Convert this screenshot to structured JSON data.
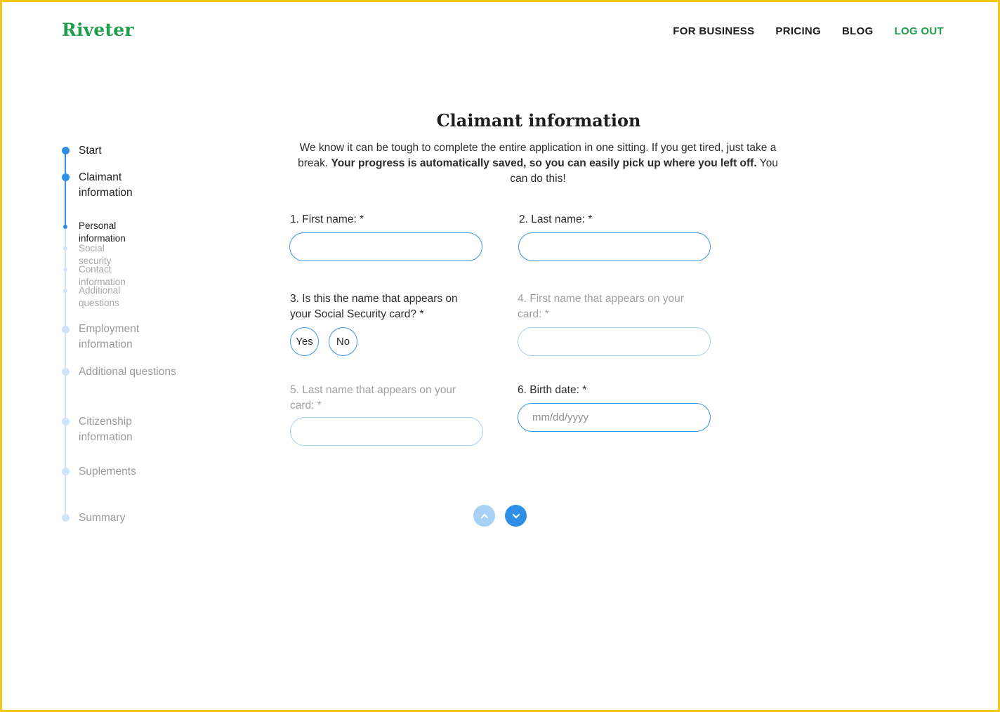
{
  "brand": {
    "logo": "Riveter",
    "color": "#1e9e4a"
  },
  "nav": {
    "for_business": "FOR BUSINESS",
    "pricing": "PRICING",
    "blog": "BLOG",
    "logout": "LOG OUT"
  },
  "stepper": {
    "steps": [
      {
        "label": "Start",
        "state": "complete"
      },
      {
        "label": "Claimant information",
        "state": "current"
      },
      {
        "label": "Employment information",
        "state": "pending"
      },
      {
        "label": "Additional questions",
        "state": "pending"
      },
      {
        "label": "Citizenship information",
        "state": "pending"
      },
      {
        "label": "Suplements",
        "state": "pending"
      },
      {
        "label": "Summary",
        "state": "pending"
      }
    ],
    "substeps": [
      {
        "label": "Personal information",
        "state": "current"
      },
      {
        "label": "Social security",
        "state": "pending"
      },
      {
        "label": "Contact information",
        "state": "pending"
      },
      {
        "label": "Additional questions",
        "state": "pending"
      }
    ],
    "active_color": "#2f8fe6",
    "pending_color": "#cfe4f8"
  },
  "page": {
    "title": "Claimant information",
    "intro_plain": "We know it can be tough to complete the entire application in one sitting. If you get tired, just take a break. ",
    "intro_bold": "Your progress is automatically saved, so you can easily pick up where you left off.",
    "intro_end": " You can do this!"
  },
  "form": {
    "q1": {
      "label": "1. First name: *",
      "value": ""
    },
    "q2": {
      "label": "2. Last name: *",
      "value": ""
    },
    "q3": {
      "label": "3. Is this the name that appears on your Social Security card? *",
      "yes": "Yes",
      "no": "No"
    },
    "q4": {
      "label": "4. First name that appears on your card: *",
      "value": ""
    },
    "q5": {
      "label": "5. Last name that appears on your card: *",
      "value": ""
    },
    "q6": {
      "label": "6. Birth date: *",
      "placeholder": "mm/dd/yyyy"
    }
  },
  "pager": {
    "up_icon": "chevron-up-icon",
    "down_icon": "chevron-down-icon"
  }
}
